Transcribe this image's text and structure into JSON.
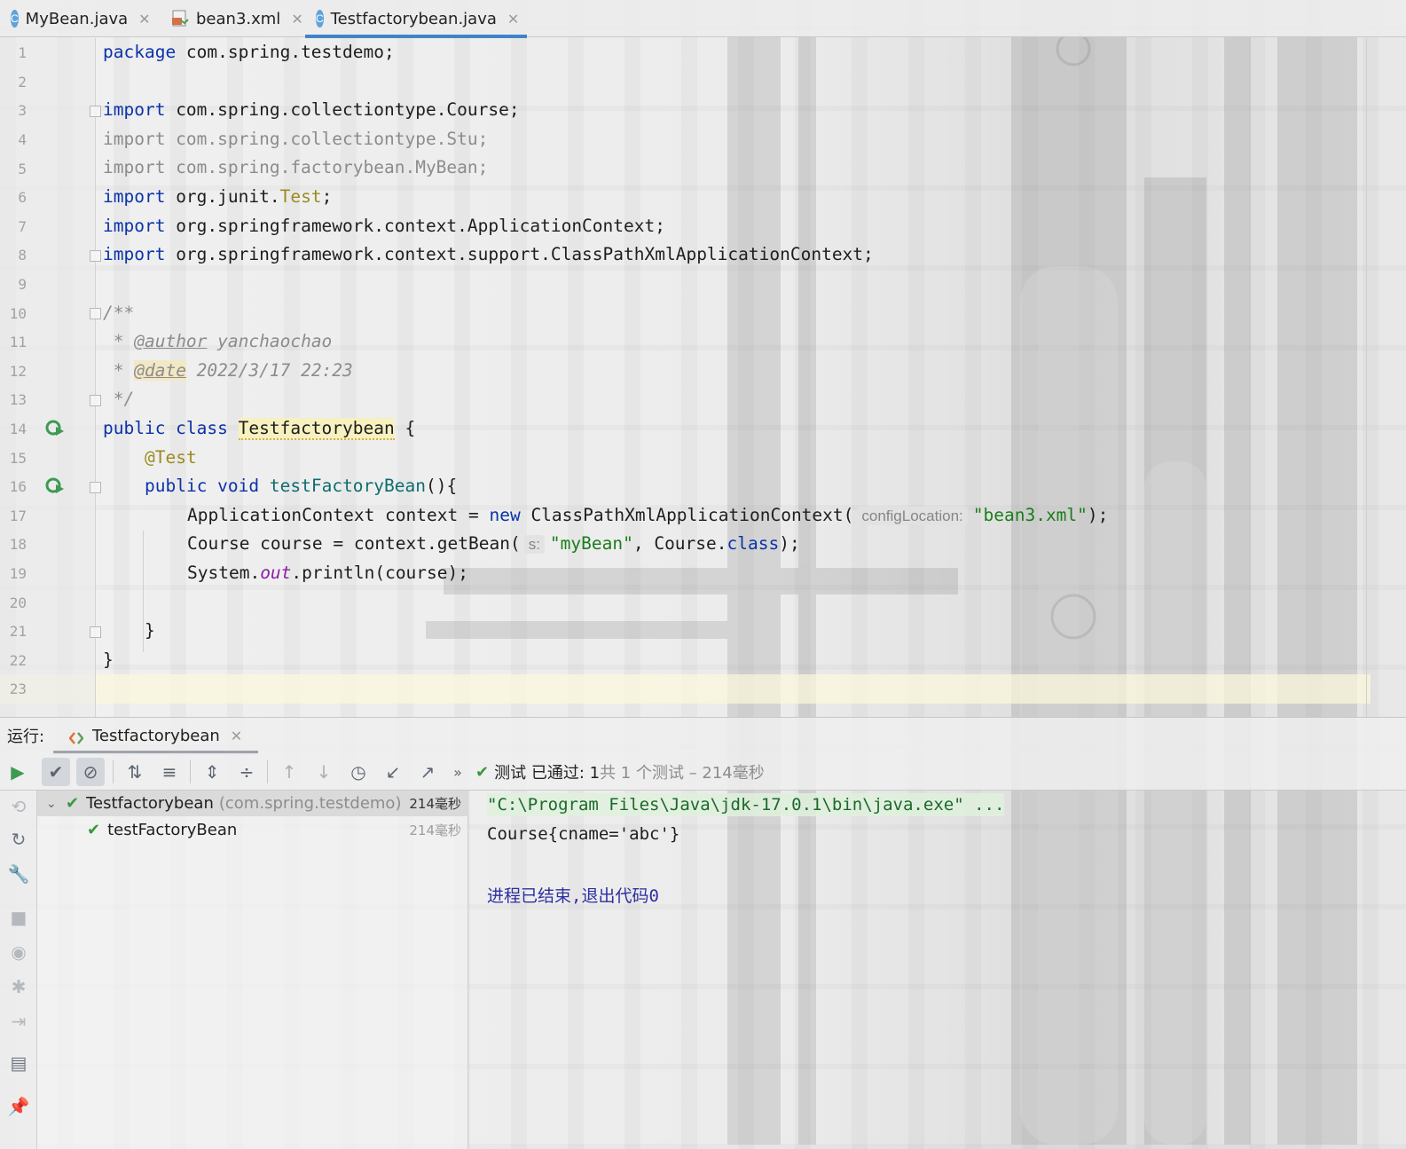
{
  "tabs": [
    {
      "label": "MyBean.java",
      "icon": "java-class-icon",
      "active": false
    },
    {
      "label": "bean3.xml",
      "icon": "xml-file-icon",
      "active": false
    },
    {
      "label": "Testfactorybean.java",
      "icon": "java-test-class-icon",
      "active": true
    }
  ],
  "editor": {
    "line_numbers": [
      "1",
      "2",
      "3",
      "4",
      "5",
      "6",
      "7",
      "8",
      "9",
      "10",
      "11",
      "12",
      "13",
      "14",
      "15",
      "16",
      "17",
      "18",
      "19",
      "20",
      "21",
      "22",
      "23"
    ],
    "code": {
      "l1_kw": "package",
      "l1_rest": " com.spring.testdemo;",
      "l3_kw": "import",
      "l3_rest": " com.spring.collectiontype.Course;",
      "l4": "import com.spring.collectiontype.Stu;",
      "l5": "import com.spring.factorybean.MyBean;",
      "l6_kw": "import",
      "l6_a": " org.junit.",
      "l6_b": "Test",
      "l6_c": ";",
      "l7_kw": "import",
      "l7_rest": " org.springframework.context.ApplicationContext;",
      "l8_kw": "import",
      "l8_rest": " org.springframework.context.support.ClassPathXmlApplicationContext;",
      "l10": "/**",
      "l11_a": " * ",
      "l11_tag": "@author",
      "l11_b": " yanchaochao",
      "l12_a": " * ",
      "l12_tag": "@date",
      "l12_b": " 2022/3/17 22:23",
      "l13": " */",
      "l14_kw": "public class ",
      "l14_cls": "Testfactorybean",
      "l14_rest": " {",
      "l15": "@Test",
      "l16_kw": "public void ",
      "l16_m": "testFactoryBean",
      "l16_rest": "(){",
      "l17_a": "ApplicationContext context = ",
      "l17_kw": "new",
      "l17_b": " ClassPathXmlApplicationContext(",
      "l17_hint": "configLocation:",
      "l17_str": "\"bean3.xml\"",
      "l17_c": ");",
      "l18_a": "Course course = context.getBean(",
      "l18_hint": "s:",
      "l18_str": "\"myBean\"",
      "l18_b": ", Course.",
      "l18_kw": "class",
      "l18_c": ");",
      "l19_a": "System.",
      "l19_out": "out",
      "l19_b": ".println(course);",
      "l21": "}",
      "l22": "}"
    }
  },
  "run_panel": {
    "label": "运行:",
    "tab_label": "Testfactorybean",
    "status_prefix": "测试 已通过: 1",
    "status_summary": "共 1 个测试 – 214毫秒",
    "tree": [
      {
        "name": "Testfactorybean",
        "package": "(com.spring.testdemo)",
        "time": "214毫秒"
      },
      {
        "name": "testFactoryBean",
        "time": "214毫秒"
      }
    ],
    "console": {
      "cmd": "\"C:\\Program Files\\Java\\jdk-17.0.1\\bin\\java.exe\" ...",
      "output": "Course{cname='abc'}",
      "exit": "进程已结束,退出代码0"
    }
  },
  "colors": {
    "accent": "#4083c9",
    "pass_green": "#3a9a3a",
    "keyword": "#0b33a8",
    "string": "#1a7d1a"
  }
}
